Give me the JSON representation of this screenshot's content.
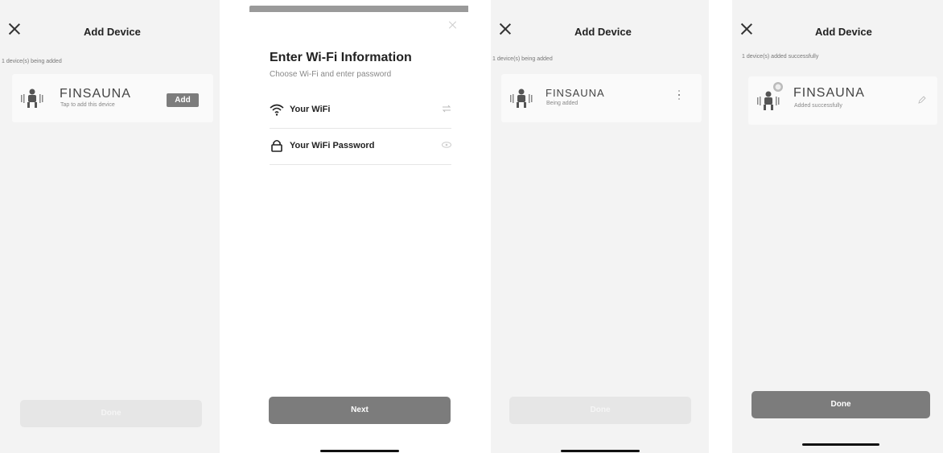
{
  "screen1": {
    "title": "Add Device",
    "subline": "1 device(s) being added",
    "brand": "FINSAUNA",
    "device_sub": "Tap to add this device",
    "add_label": "Add",
    "done_label": "Done"
  },
  "screen2": {
    "title": "Enter Wi-Fi Information",
    "subtitle": "Choose Wi-Fi and enter password",
    "wifi_label": "Your WiFi",
    "password_label": "Your WiFi Password",
    "next_label": "Next"
  },
  "screen3": {
    "title": "Add Device",
    "subline": "1 device(s) being added",
    "brand": "FINSAUNA",
    "device_sub": "Being added",
    "done_label": "Done"
  },
  "screen4": {
    "title": "Add Device",
    "subline": "1 device(s) added successfully",
    "brand": "FINSAUNA",
    "device_sub": "Added successfully",
    "done_label": "Done"
  },
  "colors": {
    "button_gray": "#7c7c7c",
    "disabled": "#e6e6e6",
    "background": "#f3f3f3"
  },
  "icons": [
    "close-icon",
    "device-icon",
    "wifi-icon",
    "lock-icon",
    "swap-icon",
    "eye-icon",
    "loading-icon",
    "edit-icon",
    "success-badge-icon"
  ]
}
